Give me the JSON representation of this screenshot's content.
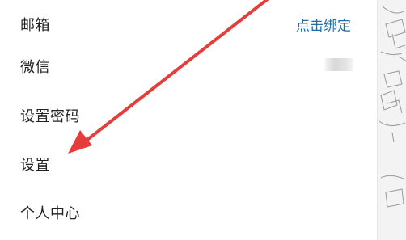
{
  "menu": {
    "items": [
      {
        "label": "邮箱",
        "action": "点击绑定"
      },
      {
        "label": "微信"
      },
      {
        "label": "设置密码"
      },
      {
        "label": "设置"
      },
      {
        "label": "个人中心"
      }
    ]
  },
  "colors": {
    "link": "#1e6cab",
    "text": "#222222",
    "annotation_arrow": "#e53c3c"
  }
}
